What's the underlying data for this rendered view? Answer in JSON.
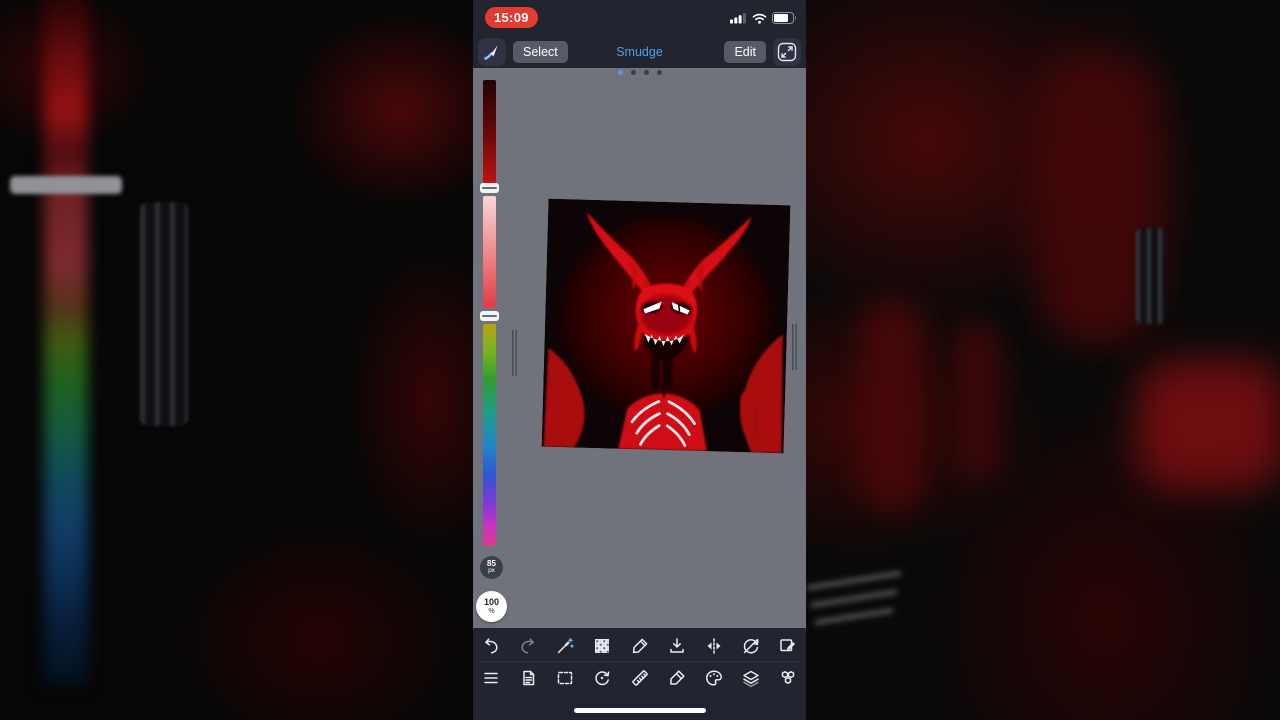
{
  "status_bar": {
    "time": "15:09"
  },
  "top_toolbar": {
    "select_label": "Select",
    "mode_label": "Smudge",
    "edit_label": "Edit"
  },
  "page_dots": {
    "total": 4,
    "active_index": 0
  },
  "side_panel": {
    "size_badge": {
      "value": "85",
      "unit": "px"
    },
    "opacity_badge": {
      "value": "100",
      "unit": "%"
    }
  },
  "icons": {
    "status": [
      "cellular-signal-icon",
      "wifi-icon",
      "battery-icon"
    ],
    "top": [
      "brush-icon",
      "fullscreen-icon"
    ],
    "toolbar_row1": [
      "undo-icon",
      "redo-icon",
      "magic-wand-icon",
      "transparency-checker-icon",
      "pen-icon",
      "import-icon",
      "mirror-flip-icon",
      "rotate-lock-icon",
      "deselect-icon"
    ],
    "toolbar_row2": [
      "menu-icon",
      "pages-icon",
      "selection-tool-icon",
      "rotate-canvas-icon",
      "ruler-icon",
      "marker-icon",
      "palette-icon",
      "layers-icon",
      "materials-icon"
    ]
  },
  "colors": {
    "accent_blue": "#4f9fe8",
    "time_pill_red": "#e23b34",
    "toolbar_bg": "#22242f",
    "canvas_grey": "#70737b",
    "button_grey": "#585b66"
  }
}
